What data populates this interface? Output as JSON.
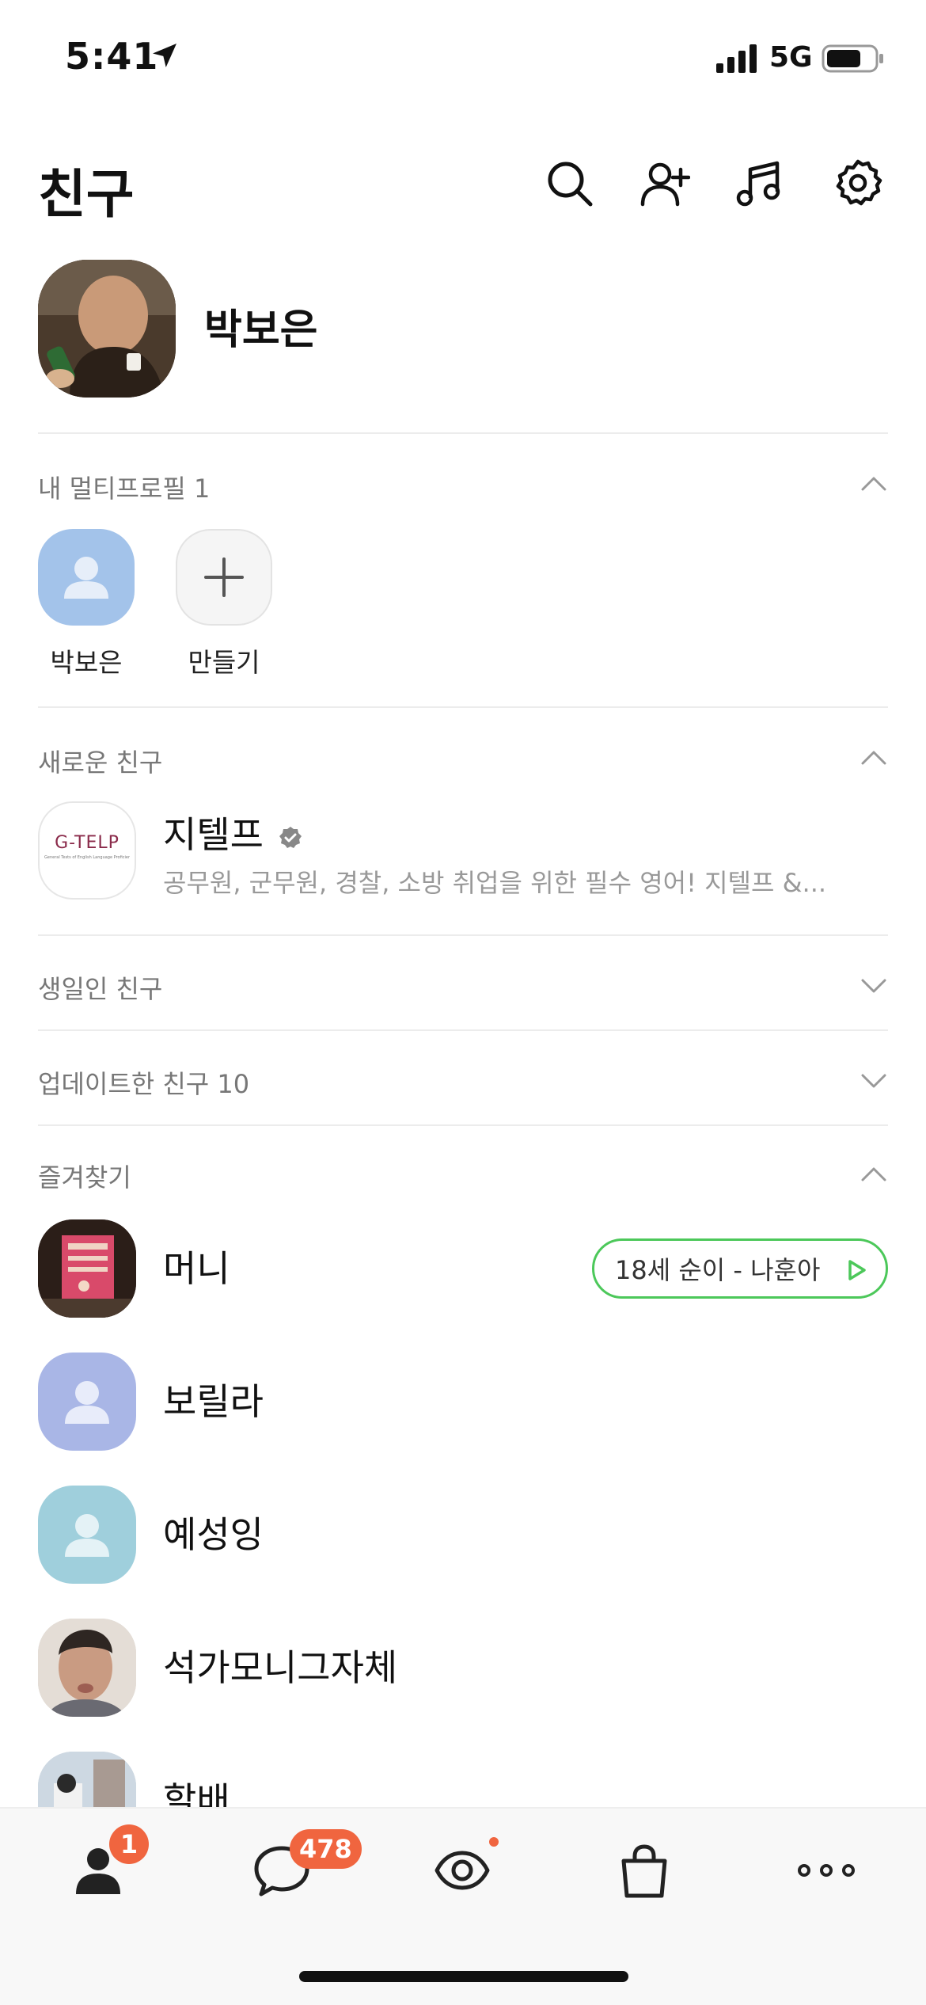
{
  "status_bar": {
    "time": "5:41",
    "network": "5G"
  },
  "header": {
    "title": "친구"
  },
  "profile": {
    "name": "박보은"
  },
  "multi_profile": {
    "title": "내 멀티프로필 1",
    "items": [
      {
        "label": "박보은"
      },
      {
        "label": "만들기"
      }
    ]
  },
  "new_friends": {
    "title": "새로운 친구",
    "item": {
      "name": "지텔프",
      "logo_text": "G-TELP",
      "logo_sub": "General Tests of English Language Proficiency",
      "description": "공무원, 군무원, 경찰, 소방 취업을 위한 필수 영어! 지텔프 &..."
    }
  },
  "birthday": {
    "title": "생일인 친구"
  },
  "updated": {
    "title": "업데이트한 친구 10"
  },
  "favorites": {
    "title": "즐겨찾기",
    "items": [
      {
        "name": "머니",
        "music": "18세 순이 - 나훈아"
      },
      {
        "name": "보릴라"
      },
      {
        "name": "예성잉"
      },
      {
        "name": "석가모니그자체"
      },
      {
        "name": "할배"
      }
    ]
  },
  "tab_bar": {
    "friends_badge": "1",
    "chats_badge": "478"
  },
  "colors": {
    "accent_badge": "#f0653f",
    "music_pill_border": "#4cc85a",
    "avatar_blue": "#a3c3ea",
    "avatar_purple": "#a9b6e6",
    "avatar_teal": "#9fcfdc"
  }
}
